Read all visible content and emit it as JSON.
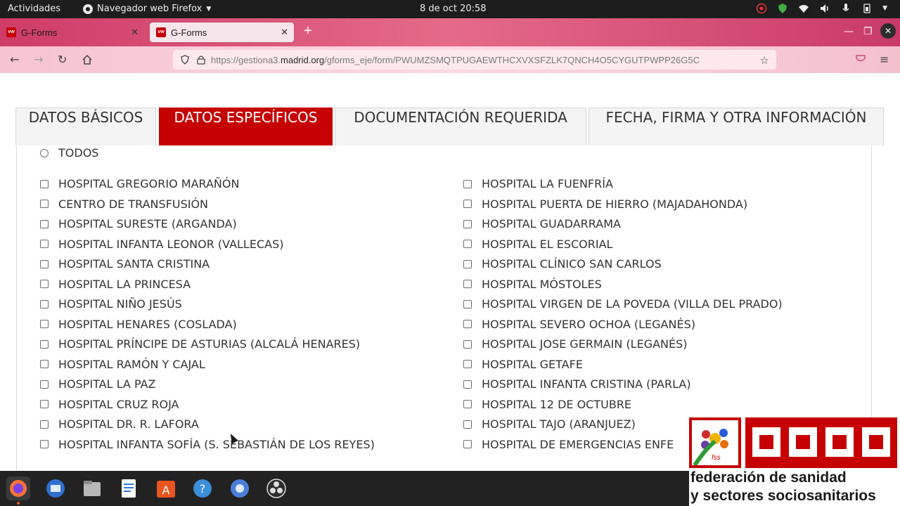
{
  "system": {
    "activities": "Actividades",
    "app_name": "Navegador web Firefox",
    "clock": "8 de oct  20:58"
  },
  "browser": {
    "tabs": [
      {
        "label": "G-Forms",
        "active": false
      },
      {
        "label": "G-Forms",
        "active": true
      }
    ],
    "url_prefix": "https://gestiona3.",
    "url_domain": "madrid.org",
    "url_path": "/gforms_eje/form/PWUMZSMQTPUGAEWTHCXVXSFZLK7QNCH4O5CYGUTPWPP26G5C"
  },
  "form": {
    "tabs": [
      {
        "label": "DATOS BÁSICOS",
        "active": false
      },
      {
        "label": "DATOS ESPECÍFICOS",
        "active": true
      },
      {
        "label": "DOCUMENTACIÓN REQUERIDA",
        "active": false
      },
      {
        "label": "FECHA, FIRMA Y OTRA INFORMACIÓN",
        "active": false
      }
    ],
    "todos_label": "TODOS",
    "hospitals_left": [
      "HOSPITAL GREGORIO MARAÑÓN",
      "CENTRO DE TRANSFUSIÓN",
      "HOSPITAL SURESTE (ARGANDA)",
      "HOSPITAL INFANTA LEONOR (VALLECAS)",
      "HOSPITAL SANTA CRISTINA",
      "HOSPITAL LA PRINCESA",
      "HOSPITAL NIÑO JESÚS",
      "HOSPITAL HENARES (COSLADA)",
      "HOSPITAL PRÍNCIPE DE ASTURIAS (ALCALÁ HENARES)",
      "HOSPITAL RAMÓN Y CAJAL",
      "HOSPITAL LA PAZ",
      "HOSPITAL CRUZ ROJA",
      "HOSPITAL DR. R. LAFORA",
      "HOSPITAL INFANTA SOFÍA (S. SEBASTIÁN DE LOS REYES)"
    ],
    "hospitals_right": [
      "HOSPITAL LA FUENFRÍA",
      "HOSPITAL PUERTA DE HIERRO (MAJADAHONDA)",
      "HOSPITAL GUADARRAMA",
      "HOSPITAL EL ESCORIAL",
      "HOSPITAL CLÍNICO SAN CARLOS",
      "HOSPITAL MÓSTOLES",
      "HOSPITAL VIRGEN DE LA POVEDA (VILLA DEL PRADO)",
      "HOSPITAL SEVERO OCHOA (LEGANÉS)",
      "HOSPITAL JOSE GERMAIN (LEGANÉS)",
      "HOSPITAL GETAFE",
      "HOSPITAL INFANTA CRISTINA (PARLA)",
      "HOSPITAL 12 DE OCTUBRE",
      "HOSPITAL TAJO (ARANJUEZ)",
      "HOSPITAL DE EMERGENCIAS ENFE"
    ]
  },
  "overlay": {
    "logo_line1": "federación de sanidad",
    "logo_line2": "y sectores sociosanitarios",
    "fss_label": "fss"
  },
  "colors": {
    "accent_red": "#c60000",
    "tab_gradient": "#d8466f"
  }
}
